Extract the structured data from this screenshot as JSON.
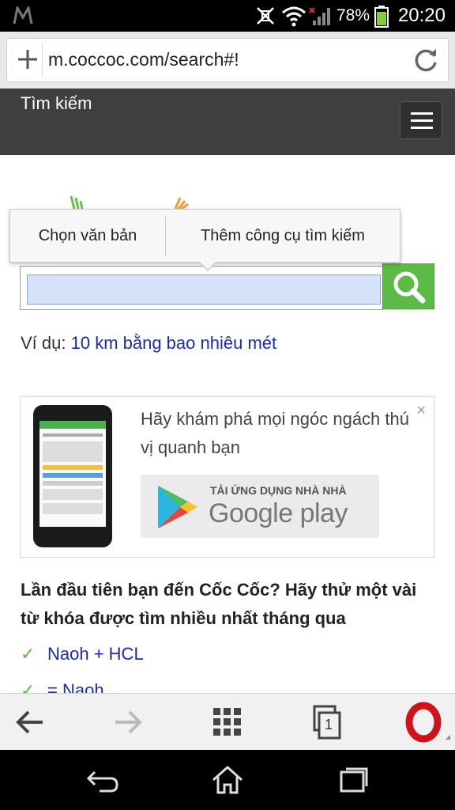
{
  "status_bar": {
    "battery_percent": "78%",
    "time": "20:20",
    "icons": [
      "notification-m-icon",
      "vibrate-off-icon",
      "wifi-icon",
      "signal-icon",
      "battery-icon"
    ]
  },
  "browser": {
    "url": "m.coccoc.com/search#!",
    "toolbar_icons": [
      "back-icon",
      "forward-icon",
      "speed-dial-icon",
      "tabs-icon",
      "opera-menu-icon"
    ],
    "tab_count": "1"
  },
  "site": {
    "header_title": "Tìm kiếm"
  },
  "popup": {
    "options": [
      "Chọn văn bản",
      "Thêm công cụ tìm kiếm"
    ]
  },
  "search": {
    "value": "",
    "placeholder": ""
  },
  "example": {
    "prefix": "Ví dụ:",
    "link": "10 km bằng bao nhiêu mét"
  },
  "promo": {
    "text": "Hãy khám phá mọi ngóc ngách thú vị quanh bạn",
    "close": "×",
    "store_small": "TẢI ỨNG DỤNG NHÀ NHÀ",
    "store_big": "Google play"
  },
  "suggestions": {
    "heading": "Lần đầu tiên bạn đến Cốc Cốc? Hãy thử một vài từ khóa được tìm nhiều nhất tháng qua",
    "check": "✓",
    "items": [
      "Naoh + HCL",
      "= Naoh"
    ]
  },
  "colors": {
    "accent_green": "#5cbb45",
    "link_blue": "#1a2ab8",
    "header_dark": "#3f3f3f"
  }
}
